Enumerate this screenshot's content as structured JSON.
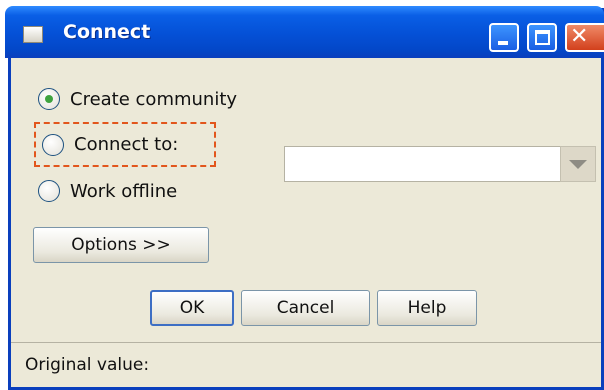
{
  "window": {
    "title": "Connect",
    "title_icon": "app-window-icon"
  },
  "title_buttons": {
    "minimize_icon": "minimize-icon",
    "maximize_icon": "maximize-icon",
    "close_glyph": "✕"
  },
  "options": [
    {
      "label": "Create community",
      "selected": true
    },
    {
      "label": "Connect to:",
      "selected": false
    },
    {
      "label": "Work offline",
      "selected": false
    }
  ],
  "connect_target": {
    "value": "",
    "dropdown_icon": "chevron-down-icon"
  },
  "buttons": {
    "options_label": "Options >>",
    "ok_label": "OK",
    "cancel_label": "Cancel",
    "help_label": "Help"
  },
  "status": {
    "text": "Original value:"
  },
  "colors": {
    "titlebar": "#0450d6",
    "selected_radio": "#3fa33f",
    "focus_outline": "#e2561c",
    "dialog_bg": "#ece9d8"
  }
}
